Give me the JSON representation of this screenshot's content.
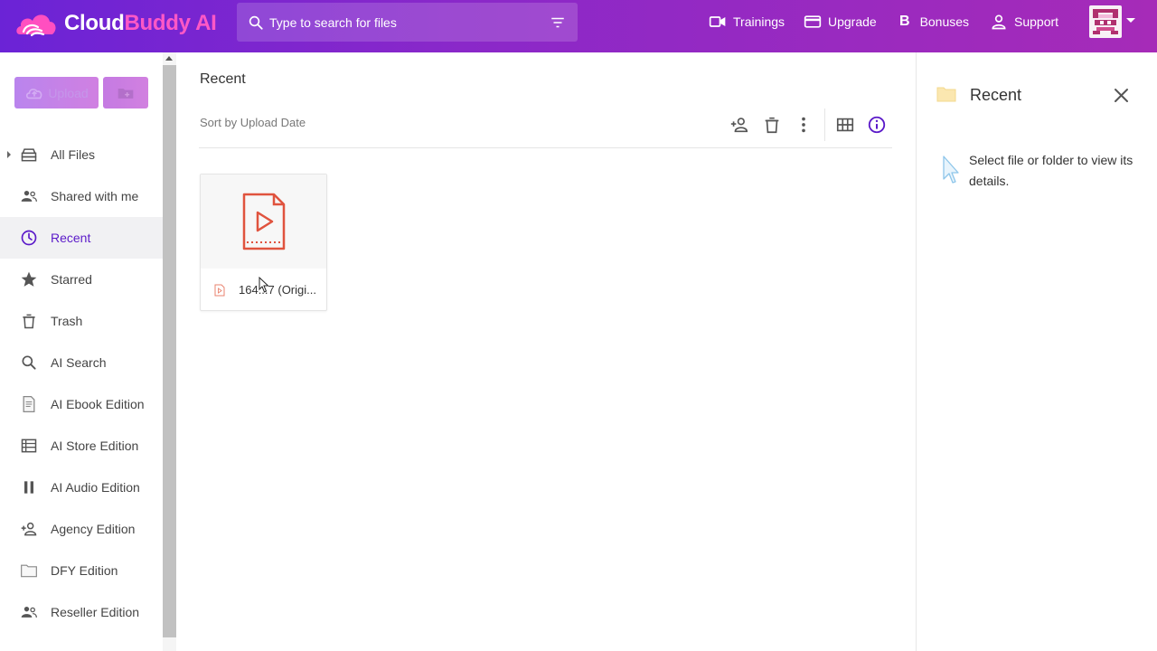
{
  "header": {
    "logo_part1": "Cloud",
    "logo_part2": "Buddy AI",
    "search_placeholder": "Type to search for files",
    "nav": [
      {
        "label": "Trainings",
        "icon": "video-camera-icon"
      },
      {
        "label": "Upgrade",
        "icon": "credit-card-icon"
      },
      {
        "label": "Bonuses",
        "icon": "letter-b-icon",
        "glyph": "B"
      },
      {
        "label": "Support",
        "icon": "person-icon"
      }
    ],
    "colors": {
      "gradient_start": "#6b23d6",
      "gradient_end": "#a62bb8",
      "logo_accent": "#ff58c6"
    }
  },
  "sidebar": {
    "upload_label": "Upload",
    "items": [
      {
        "label": "All Files",
        "icon": "drive-stack-icon"
      },
      {
        "label": "Shared with me",
        "icon": "people-icon"
      },
      {
        "label": "Recent",
        "icon": "clock-icon",
        "active": true
      },
      {
        "label": "Starred",
        "icon": "star-icon"
      },
      {
        "label": "Trash",
        "icon": "trash-icon"
      },
      {
        "label": "AI Search",
        "icon": "search-icon"
      },
      {
        "label": "AI Ebook Edition",
        "icon": "document-icon"
      },
      {
        "label": "AI Store Edition",
        "icon": "list-icon"
      },
      {
        "label": "AI Audio Edition",
        "icon": "pause-icon"
      },
      {
        "label": "Agency Edition",
        "icon": "person-add-icon"
      },
      {
        "label": "DFY Edition",
        "icon": "folder-outline-icon"
      },
      {
        "label": "Reseller Edition",
        "icon": "people-icon"
      }
    ],
    "colors": {
      "active_text": "#5b1ac9"
    }
  },
  "main": {
    "title": "Recent",
    "sort_label": "Sort by Upload Date",
    "files": [
      {
        "name": "164...7 (Origi...",
        "type": "video-file-icon"
      }
    ]
  },
  "panel": {
    "title": "Recent",
    "message": "Select file or folder to view its details."
  }
}
